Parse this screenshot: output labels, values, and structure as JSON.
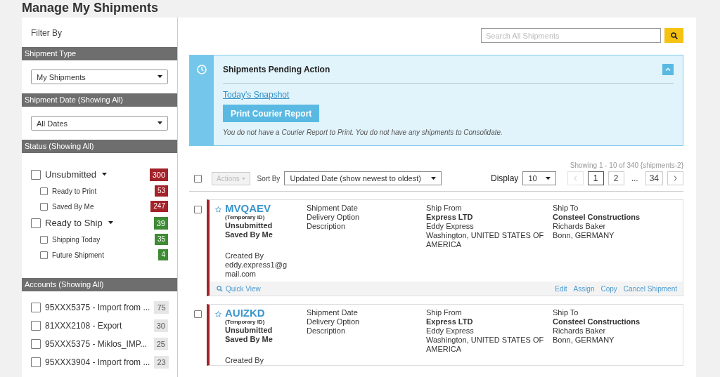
{
  "page_title": "Manage My Shipments",
  "sidebar": {
    "heading": "Filter By",
    "sections": [
      {
        "kind": "select",
        "title": "Shipment Type",
        "value": "My Shipments"
      },
      {
        "kind": "select",
        "title": "Shipment Date (Showing All)",
        "value": "All Dates"
      },
      {
        "kind": "status",
        "title": "Status (Showing All)",
        "items": [
          {
            "label": "Unsubmitted",
            "count": "300",
            "color": "#a3222a",
            "checked": false,
            "children": [
              {
                "label": "Ready to Print",
                "count": "53",
                "color": "#a3222a",
                "checked": false
              },
              {
                "label": "Saved By Me",
                "count": "247",
                "color": "#a3222a",
                "checked": false
              }
            ]
          },
          {
            "label": "Ready to Ship",
            "count": "39",
            "color": "#3f8a35",
            "checked": false,
            "children": [
              {
                "label": "Shipping Today",
                "count": "35",
                "color": "#3f8a35",
                "checked": false
              },
              {
                "label": "Future Shipment",
                "count": "4",
                "color": "#3f8a35",
                "checked": false
              }
            ]
          }
        ]
      },
      {
        "kind": "accounts",
        "title": "Accounts (Showing All)",
        "items": [
          {
            "label": "95XXX5375 - Import from ...",
            "count": "75",
            "checked": false
          },
          {
            "label": "81XXX2108 - Export",
            "count": "30",
            "checked": false
          },
          {
            "label": "95XXX5375 - Miklos_IMP...",
            "count": "25",
            "checked": false
          },
          {
            "label": "95XXX3904 - Import from ...",
            "count": "23",
            "checked": false
          }
        ]
      }
    ]
  },
  "search": {
    "placeholder": "Search All Shipments"
  },
  "pending": {
    "title": "Shipments Pending Action",
    "expanded": true,
    "link": "Today's Snapshot",
    "button": "Print Courier Report",
    "message": "You do not have a Courier Report to Print. You do not have any shipments to Consolidate."
  },
  "toolbar": {
    "checked": false,
    "actions": {
      "label": "Actions",
      "disabled": true
    },
    "sort_label": "Sort By",
    "sort_value": "Updated Date (show newest to oldest)",
    "showing": "Showing 1 - 10 of 340 {shipments-2}",
    "display_label": "Display",
    "display_value": "10",
    "prev_disabled": true,
    "next_disabled": false,
    "pages": [
      {
        "kind": "page",
        "label": "1",
        "selected": true
      },
      {
        "kind": "page",
        "label": "2",
        "selected": false
      },
      {
        "kind": "ellipsis",
        "label": "..."
      },
      {
        "kind": "page",
        "label": "34",
        "selected": false
      }
    ]
  },
  "shipments": [
    {
      "checked": false,
      "starred": false,
      "id": "MVQAEV",
      "id_note": "(Temporary ID)",
      "status": "Unsubmitted",
      "substatus": "Saved By Me",
      "created_label": "Created By",
      "created_by": "eddy.express1@gmail.com",
      "details": [
        "Shipment Date",
        "Delivery Option",
        "Description"
      ],
      "ship_from": {
        "label": "Ship From",
        "company": "Express LTD",
        "contact": "Eddy Express",
        "address": "Washington, UNITED STATES OF AMERICA"
      },
      "ship_to": {
        "label": "Ship To",
        "company": "Consteel Constructions",
        "contact": "Richards Baker",
        "address": "Bonn, GERMANY"
      },
      "footer": {
        "quick_view": "Quick View",
        "actions": [
          "Edit",
          "Assign",
          "Copy",
          "Cancel Shipment"
        ]
      }
    },
    {
      "checked": false,
      "starred": false,
      "id": "AUIZKD",
      "id_note": "(Temporary ID)",
      "status": "Unsubmitted",
      "substatus": "Saved By Me",
      "created_label": "Created By",
      "details": [
        "Shipment Date",
        "Delivery Option",
        "Description"
      ],
      "ship_from": {
        "label": "Ship From",
        "company": "Express LTD",
        "contact": "Eddy Express",
        "address": "Washington, UNITED STATES OF AMERICA"
      },
      "ship_to": {
        "label": "Ship To",
        "company": "Consteel Constructions",
        "contact": "Richards Baker",
        "address": "Bonn, GERMANY"
      }
    }
  ]
}
